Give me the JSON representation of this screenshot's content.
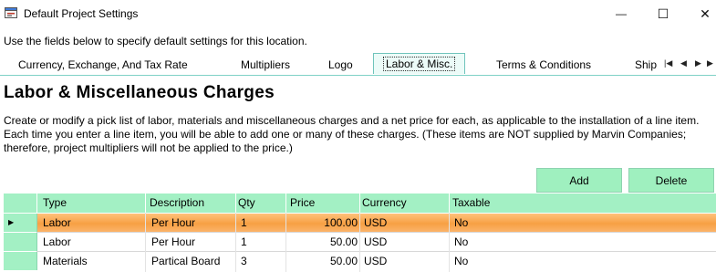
{
  "window": {
    "title": "Default Project Settings",
    "minimize_glyph": "—",
    "maximize_glyph": "☐",
    "close_glyph": "✕"
  },
  "instructions": "Use the fields below to specify default settings for this location.",
  "tabs": [
    {
      "label": "Currency, Exchange, And Tax Rate"
    },
    {
      "label": "Multipliers"
    },
    {
      "label": "Logo"
    },
    {
      "label": "Labor & Misc."
    },
    {
      "label": "Terms & Conditions"
    },
    {
      "label": "Ship"
    }
  ],
  "selected_tab": "Labor & Misc.",
  "tab_scroll_icons": [
    "scroll-first-icon",
    "scroll-prev-icon",
    "scroll-next-icon",
    "scroll-last-icon"
  ],
  "heading": "Labor & Miscellaneous Charges",
  "description": "Create or modify a pick list of labor, materials and miscellaneous charges and a net price for each, as applicable to the installation of a line item. Each time you enter a line item, you will be able to add one or many of these charges. (These items are NOT supplied by Marvin Companies; therefore, project multipliers will not be applied to the price.)",
  "buttons": {
    "add": "Add",
    "delete": "Delete"
  },
  "grid": {
    "columns": [
      "Type",
      "Description",
      "Qty",
      "Price",
      "Currency",
      "Taxable"
    ],
    "rows": [
      {
        "type": "Labor",
        "description": "Per Hour",
        "qty": "1",
        "price": "100.00",
        "currency": "USD",
        "taxable": "No"
      },
      {
        "type": "Labor",
        "description": "Per Hour",
        "qty": "1",
        "price": "50.00",
        "currency": "USD",
        "taxable": "No"
      },
      {
        "type": "Materials",
        "description": "Partical Board",
        "qty": "3",
        "price": "50.00",
        "currency": "USD",
        "taxable": "No"
      }
    ],
    "selected_row": 0
  },
  "colors": {
    "accent_green": "#a3f0c4",
    "selected_row": "#f7a044",
    "tab_border": "#6fc4bb"
  }
}
